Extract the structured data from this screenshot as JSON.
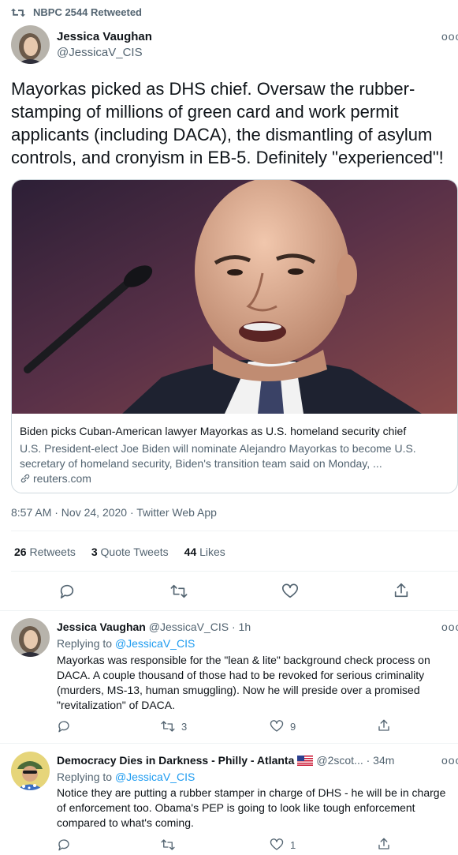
{
  "retweet_label": "NBPC 2544 Retweeted",
  "more_label": "ooo",
  "main_tweet": {
    "name": "Jessica Vaughan",
    "handle": "@JessicaV_CIS",
    "text": "Mayorkas picked as DHS chief. Oversaw the rubber-stamping of millions of green card and work permit applicants (including DACA), the dismantling of asylum controls, and cronyism in EB-5. Definitely \"experienced\"!",
    "card": {
      "title": "Biden picks Cuban-American lawyer Mayorkas as U.S. homeland security chief",
      "description": "U.S. President-elect Joe Biden will nominate Alejandro Mayorkas to become U.S. secretary of homeland security, Biden's transition team said on Monday, ...",
      "domain": "reuters.com"
    },
    "meta": "8:57 AM · Nov 24, 2020 · Twitter Web App",
    "stats": {
      "retweets_count": "26",
      "retweets_label": "Retweets",
      "quotes_count": "3",
      "quotes_label": "Quote Tweets",
      "likes_count": "44",
      "likes_label": "Likes"
    }
  },
  "replies": [
    {
      "name": "Jessica Vaughan",
      "handle": "@JessicaV_CIS",
      "time": "· 1h",
      "replying_prefix": "Replying to",
      "replying_to": "@JessicaV_CIS",
      "text": "Mayorkas was responsible for the \"lean & lite\" background check process on DACA.  A couple thousand of those had to be revoked for serious criminality (murders, MS-13, human smuggling). Now he will preside over a promised \"revitalization\" of DACA.",
      "retweets": "3",
      "likes": "9"
    },
    {
      "name": "Democracy Dies in Darkness - Philly - Atlanta",
      "handle": "@2scot...",
      "time": "· 34m",
      "replying_prefix": "Replying to",
      "replying_to": "@JessicaV_CIS",
      "text": "Notice they are putting a rubber stamper in charge of DHS - he will be in charge of enforcement too.  Obama's PEP is going to look like tough enforcement compared to what's coming.",
      "retweets": "",
      "likes": "1"
    }
  ],
  "colors": {
    "accent": "#1d9bf0",
    "text": "#0f1419",
    "muted": "#536471",
    "border": "#cfd9de"
  }
}
